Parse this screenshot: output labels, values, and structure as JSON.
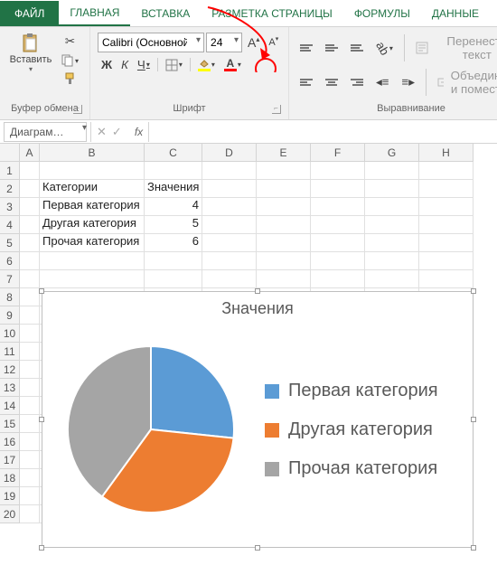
{
  "tabs": {
    "file": "ФАЙЛ",
    "home": "ГЛАВНАЯ",
    "insert": "ВСТАВКА",
    "page_layout": "РАЗМЕТКА СТРАНИЦЫ",
    "formulas": "ФОРМУЛЫ",
    "data": "ДАННЫЕ"
  },
  "ribbon": {
    "clipboard": {
      "paste": "Вставить",
      "group_label": "Буфер обмена"
    },
    "font": {
      "name": "Calibri (Основной",
      "size": "24",
      "bold": "Ж",
      "italic": "К",
      "underline": "Ч",
      "group_label": "Шрифт"
    },
    "alignment": {
      "wrap": "Перенести текст",
      "merge": "Объединить и поместить",
      "group_label": "Выравнивание"
    }
  },
  "namebox": "Диаграм…",
  "fx_label": "fx",
  "columns": [
    "A",
    "B",
    "C",
    "D",
    "E",
    "F",
    "G",
    "H"
  ],
  "rows": [
    "1",
    "2",
    "3",
    "4",
    "5",
    "6",
    "7",
    "8",
    "9",
    "10",
    "11",
    "12",
    "13",
    "14",
    "15",
    "16",
    "17",
    "18",
    "19",
    "20"
  ],
  "table": {
    "b2": "Категории",
    "c2": "Значения",
    "b3": "Первая категория",
    "c3": "4",
    "b4": "Другая категория",
    "c4": "5",
    "b5": "Прочая категория",
    "c5": "6"
  },
  "chart_data": {
    "type": "pie",
    "title": "Значения",
    "categories": [
      "Первая категория",
      "Другая категория",
      "Прочая категория"
    ],
    "values": [
      4,
      5,
      6
    ],
    "colors": [
      "#5B9BD5",
      "#ED7D31",
      "#A5A5A5"
    ],
    "legend_position": "right"
  }
}
